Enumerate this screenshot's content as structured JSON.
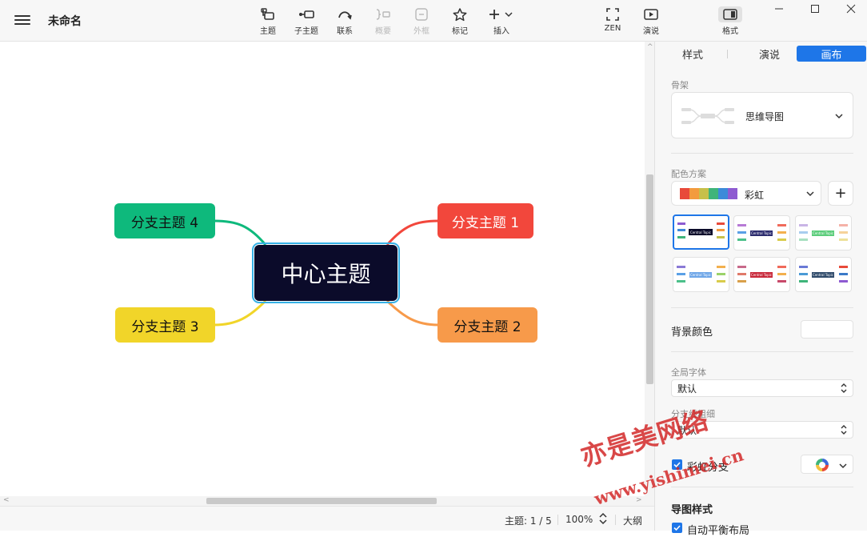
{
  "app": {
    "doc_title": "未命名"
  },
  "toolbar": {
    "tools": [
      {
        "label": "主题",
        "icon": "topic-icon",
        "enabled": true
      },
      {
        "label": "子主题",
        "icon": "subtopic-icon",
        "enabled": true
      },
      {
        "label": "联系",
        "icon": "relationship-icon",
        "enabled": true
      },
      {
        "label": "概要",
        "icon": "summary-icon",
        "enabled": false
      },
      {
        "label": "外框",
        "icon": "boundary-icon",
        "enabled": false
      },
      {
        "label": "标记",
        "icon": "star-icon",
        "enabled": true
      },
      {
        "label": "插入",
        "icon": "plus-icon",
        "enabled": true
      }
    ],
    "zen_label": "ZEN",
    "present_label": "演说",
    "format_label": "格式"
  },
  "mindmap": {
    "central": "中心主题",
    "branches": [
      {
        "label": "分支主题 1",
        "color": "#f2473c"
      },
      {
        "label": "分支主题 2",
        "color": "#f79a4a"
      },
      {
        "label": "分支主题 3",
        "color": "#f1d529"
      },
      {
        "label": "分支主题 4",
        "color": "#0eb97c"
      }
    ]
  },
  "status": {
    "topic_count": "主题: 1 / 5",
    "zoom": "100%",
    "outline": "大纲"
  },
  "panel": {
    "tabs": [
      {
        "label": "样式",
        "active": false
      },
      {
        "label": "演说",
        "active": false
      },
      {
        "label": "画布",
        "active": true
      }
    ],
    "skeleton_label": "骨架",
    "skeleton_value": "思维导图",
    "color_scheme_label": "配色方案",
    "color_scheme_value": "彩虹",
    "add_label": "+",
    "theme_thumb_text": "Central Topic",
    "background_label": "背景颜色",
    "global_font_label": "全局字体",
    "global_font_value": "默认",
    "branch_width_label": "分支线粗细",
    "branch_width_value": "默认",
    "rainbow_branch_label": "彩虹分支",
    "map_style_label": "导图样式",
    "auto_balance_label": "自动平衡布局"
  },
  "watermark": {
    "line1": "亦是美网络",
    "line2": "www.yishimei.cn"
  },
  "colors": {
    "accent": "#1e76e8",
    "central_bg": "#0b0b2a",
    "central_outline": "#35b1e6"
  }
}
